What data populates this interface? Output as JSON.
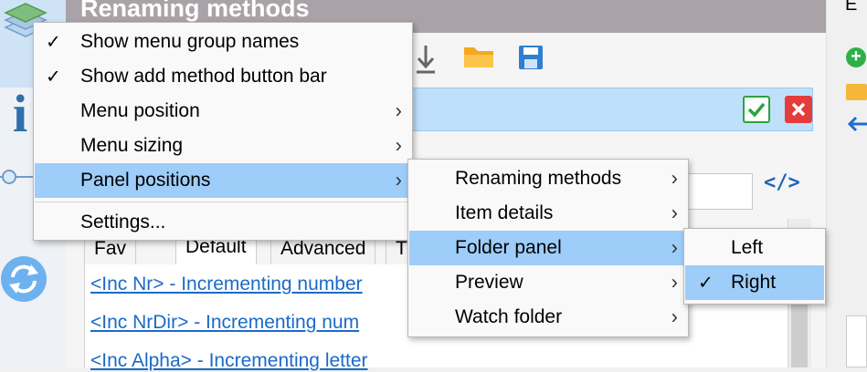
{
  "window": {
    "title": "Renaming methods",
    "right_panel_letter": "E"
  },
  "tabs": [
    {
      "label": "Fav"
    },
    {
      "label": "Default"
    },
    {
      "label": "Advanced"
    },
    {
      "label": "T"
    }
  ],
  "method_links": [
    {
      "text": "<Inc Nr> - Incrementing number"
    },
    {
      "text": "<Inc NrDir> - Incrementing num"
    },
    {
      "text": "<Inc Alpha> - Incrementing letter"
    }
  ],
  "main_menu": {
    "items": [
      {
        "label": "Show menu group names",
        "checked": true
      },
      {
        "label": "Show add method button bar",
        "checked": true
      },
      {
        "label": "Menu position",
        "submenu": true
      },
      {
        "label": "Menu sizing",
        "submenu": true
      },
      {
        "label": "Panel positions",
        "submenu": true,
        "highlighted": true
      },
      {
        "label": "Settings..."
      }
    ]
  },
  "panel_menu": {
    "items": [
      {
        "label": "Renaming methods",
        "submenu": true
      },
      {
        "label": "Item details",
        "submenu": true
      },
      {
        "label": "Folder panel",
        "submenu": true,
        "highlighted": true
      },
      {
        "label": "Preview",
        "submenu": true
      },
      {
        "label": "Watch folder",
        "submenu": true
      }
    ]
  },
  "folder_menu": {
    "items": [
      {
        "label": "Left",
        "checked": false
      },
      {
        "label": "Right",
        "checked": true,
        "highlighted": true
      }
    ]
  },
  "glyphs": {
    "check": "✓",
    "submenu_arrow": "›",
    "code_icon": "</>",
    "info_icon": "i",
    "add_icon": "+"
  },
  "colors": {
    "highlight": "#9dcdf8",
    "title_bar": "#a9a3a8",
    "link": "#1b6ac9",
    "method_bar": "#bfe0fb"
  }
}
